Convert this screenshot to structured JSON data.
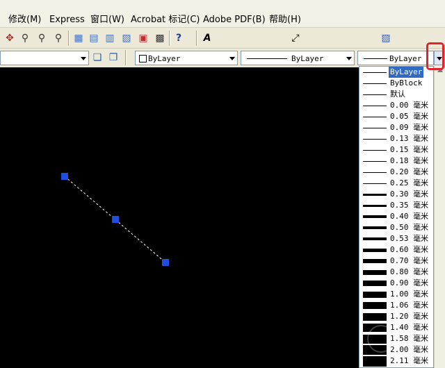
{
  "menubar": {
    "items": [
      "修改(M)",
      "Express",
      "窗口(W)",
      "Acrobat 标记(C)",
      "Adobe PDF(B)",
      "帮助(H)"
    ]
  },
  "properties": {
    "color_value": "ByLayer",
    "linetype_value": "ByLayer",
    "lineweight_value": "ByLayer"
  },
  "lineweight_options": [
    {
      "label": "ByLayer",
      "weight": 1,
      "selected": true
    },
    {
      "label": "ByBlock",
      "weight": 1
    },
    {
      "label": "默认",
      "weight": 1
    },
    {
      "label": "0.00 毫米",
      "weight": 1
    },
    {
      "label": "0.05 毫米",
      "weight": 1
    },
    {
      "label": "0.09 毫米",
      "weight": 1
    },
    {
      "label": "0.13 毫米",
      "weight": 1
    },
    {
      "label": "0.15 毫米",
      "weight": 1
    },
    {
      "label": "0.18 毫米",
      "weight": 1
    },
    {
      "label": "0.20 毫米",
      "weight": 1
    },
    {
      "label": "0.25 毫米",
      "weight": 1
    },
    {
      "label": "0.30 毫米",
      "weight": 3
    },
    {
      "label": "0.35 毫米",
      "weight": 3
    },
    {
      "label": "0.40 毫米",
      "weight": 4
    },
    {
      "label": "0.50 毫米",
      "weight": 4
    },
    {
      "label": "0.53 毫米",
      "weight": 4
    },
    {
      "label": "0.60 毫米",
      "weight": 5
    },
    {
      "label": "0.70 毫米",
      "weight": 6
    },
    {
      "label": "0.80 毫米",
      "weight": 7
    },
    {
      "label": "0.90 毫米",
      "weight": 8
    },
    {
      "label": "1.00 毫米",
      "weight": 9
    },
    {
      "label": "1.06 毫米",
      "weight": 10
    },
    {
      "label": "1.20 毫米",
      "weight": 11
    },
    {
      "label": "1.40 毫米",
      "weight": 12
    },
    {
      "label": "1.58 毫米",
      "weight": 13
    },
    {
      "label": "2.00 毫米",
      "weight": 14
    },
    {
      "label": "2.11 毫米",
      "weight": 15
    }
  ],
  "colors": {
    "canvas": "#000000",
    "grip": "#1f4fe0",
    "selection": "#316ac5",
    "callout": "#e0242a"
  }
}
